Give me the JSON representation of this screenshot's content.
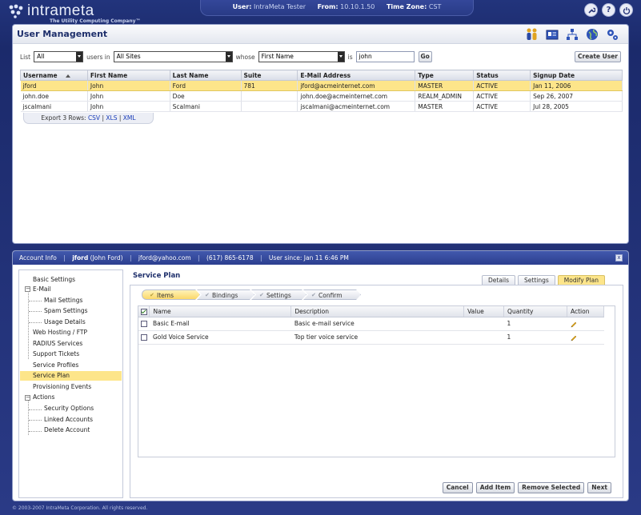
{
  "app": {
    "logo_text": "intrameta",
    "logo_tagline": "The Utility Computing Company™",
    "user_label": "User:",
    "user_value": "IntraMeta Tester",
    "from_label": "From:",
    "from_value": "10.10.1.50",
    "tz_label": "Time Zone:",
    "tz_value": "CST",
    "top_icons": [
      "wrench-icon",
      "help-icon",
      "power-icon"
    ]
  },
  "page": {
    "title": "User Management",
    "header_icons": [
      "users-icon",
      "id-card-icon",
      "network-icon",
      "globe-icon",
      "gears-icon"
    ]
  },
  "filter": {
    "list_label": "List",
    "list_value": "All",
    "users_in_label": "users in",
    "site_value": "All Sites",
    "whose_label": "whose",
    "field_value": "First Name",
    "is_label": "is",
    "query_value": "john",
    "go_label": "Go",
    "create_user_label": "Create User"
  },
  "users_table": {
    "columns": [
      "Username",
      "First Name",
      "Last Name",
      "Suite",
      "E-Mail Address",
      "Type",
      "Status",
      "Signup Date"
    ],
    "rows": [
      [
        "jford",
        "John",
        "Ford",
        "781",
        "jford@acmeinternet.com",
        "MASTER",
        "ACTIVE",
        "Jan 11, 2006"
      ],
      [
        "john.doe",
        "John",
        "Doe",
        "",
        "john.doe@acmeinternet.com",
        "REALM_ADMIN",
        "ACTIVE",
        "Sep 26, 2007"
      ],
      [
        "jscalmani",
        "John",
        "Scalmani",
        "",
        "jscalmani@acmeinternet.com",
        "MASTER",
        "ACTIVE",
        "Jul 28, 2005"
      ]
    ],
    "selected_row": 0
  },
  "export": {
    "label": "Export 3 Rows:",
    "csv": "CSV",
    "xls": "XLS",
    "xml": "XML",
    "sep": "|"
  },
  "account": {
    "label": "Account Info",
    "username": "jford",
    "fullname": "(John Ford)",
    "email": "jford@yahoo.com",
    "phone": "(617) 865-6178",
    "since": "User since: Jan 11 6:46 PM",
    "close": "x"
  },
  "nav": {
    "basic_settings": "Basic Settings",
    "email": "E-Mail",
    "mail_settings": "Mail Settings",
    "spam_settings": "Spam Settings",
    "usage_details": "Usage Details",
    "web_hosting": "Web Hosting / FTP",
    "radius": "RADIUS Services",
    "support": "Support Tickets",
    "service_profiles": "Service Profiles",
    "service_plan": "Service Plan",
    "provisioning": "Provisioning Events",
    "actions": "Actions",
    "security_options": "Security Options",
    "linked_accounts": "Linked Accounts",
    "delete_account": "Delete Account",
    "collapse_symbol": "−"
  },
  "service_plan": {
    "title": "Service Plan",
    "tabs": [
      "Details",
      "Settings",
      "Modify Plan"
    ],
    "active_tab": 2,
    "steps": [
      "Items",
      "Bindings",
      "Settings",
      "Confirm"
    ],
    "step_check": "✔",
    "items_columns": [
      "Name",
      "Description",
      "Value",
      "Quantity",
      "Action"
    ],
    "items": [
      {
        "name": "Basic E-mail",
        "description": "Basic e-mail service",
        "value": "",
        "quantity": "1"
      },
      {
        "name": "Gold Voice Service",
        "description": "Top tier voice service",
        "value": "",
        "quantity": "1"
      }
    ],
    "buttons": {
      "cancel": "Cancel",
      "add": "Add Item",
      "remove": "Remove Selected",
      "next": "Next"
    }
  },
  "footer": "© 2003-2007 IntraMeta Corporation.  All rights reserved."
}
